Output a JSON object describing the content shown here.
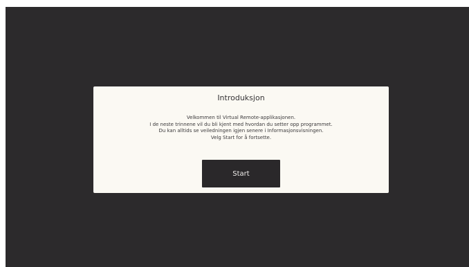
{
  "dialog": {
    "title": "Introduksjon",
    "body_lines": [
      "Velkommen til Virtual Remote-applikasjonen.",
      "I de neste trinnene vil du bli kjent med hvordan du setter opp programmet.",
      "Du kan alltids se veiledningen igjen senere i Informasjonsvisningen.",
      "Velg Start for å fortsette."
    ],
    "start_label": "Start"
  },
  "colors": {
    "background": "#2c2a2c",
    "dialog": "#fbf9f3",
    "button": "#2a282a",
    "button_text": "#f1efec"
  }
}
